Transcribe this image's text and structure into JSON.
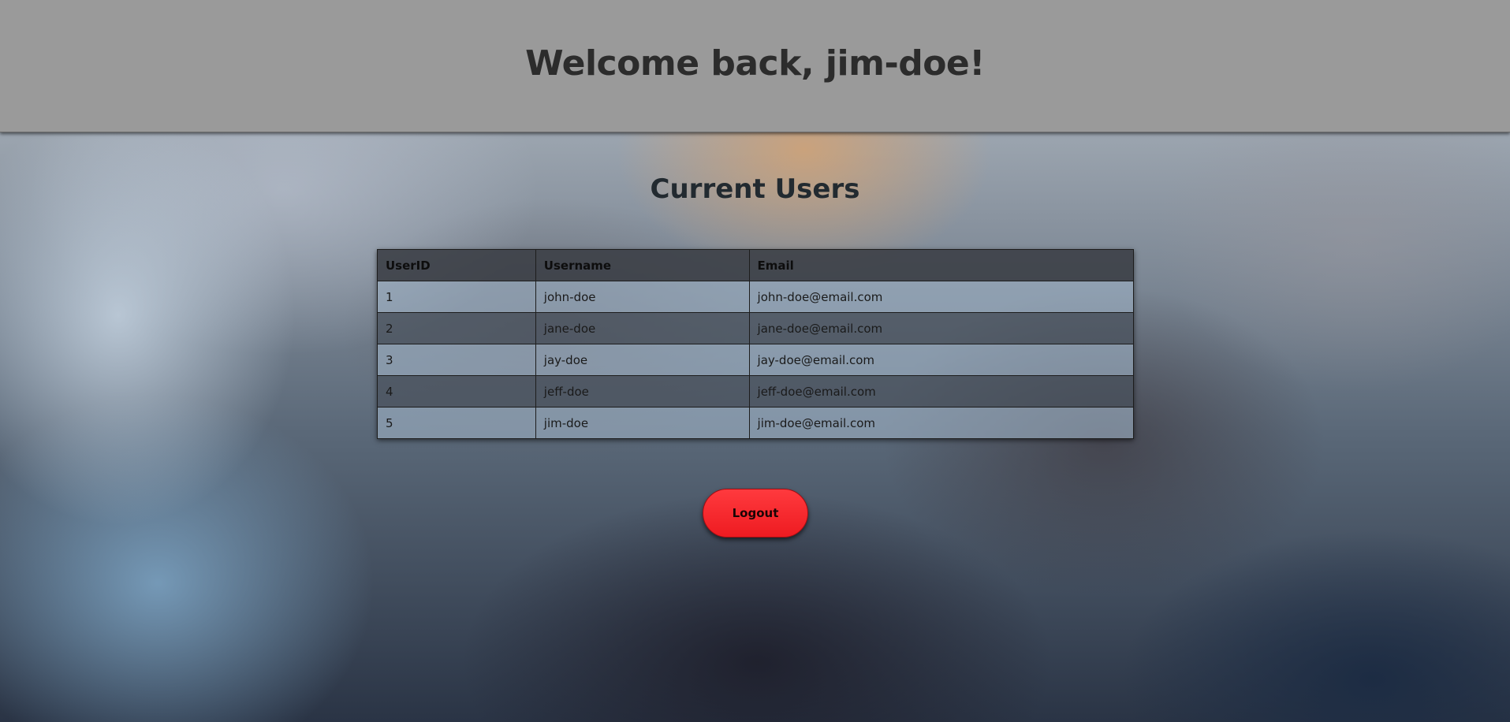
{
  "header": {
    "title": "Welcome back, jim-doe!"
  },
  "main": {
    "section_title": "Current Users",
    "table": {
      "columns": [
        "UserID",
        "Username",
        "Email"
      ],
      "rows": [
        {
          "id": "1",
          "username": "john-doe",
          "email": "john-doe@email.com"
        },
        {
          "id": "2",
          "username": "jane-doe",
          "email": "jane-doe@email.com"
        },
        {
          "id": "3",
          "username": "jay-doe",
          "email": "jay-doe@email.com"
        },
        {
          "id": "4",
          "username": "jeff-doe",
          "email": "jeff-doe@email.com"
        },
        {
          "id": "5",
          "username": "jim-doe",
          "email": "jim-doe@email.com"
        }
      ]
    },
    "logout_label": "Logout"
  },
  "colors": {
    "header_bg": "#9a9a9a",
    "logout_button": "#ff2a2f",
    "table_header_bg": "#3a3e44"
  }
}
